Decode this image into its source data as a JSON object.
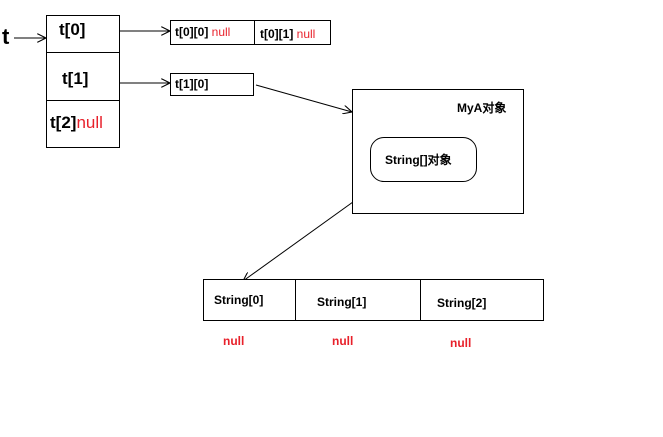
{
  "var_t": "t",
  "outer": {
    "cells": [
      {
        "label": "t[0]",
        "suffix": ""
      },
      {
        "label": "t[1]",
        "suffix": ""
      },
      {
        "label": "t[2]",
        "suffix": "null"
      }
    ]
  },
  "t0_array": {
    "cells": [
      {
        "label": "t[0][0]",
        "suffix": "null"
      },
      {
        "label": "t[0][1]",
        "suffix": "null"
      }
    ]
  },
  "t1_array": {
    "cells": [
      {
        "label": "t[1][0]"
      }
    ]
  },
  "object": {
    "title": "MyA对象",
    "inner_label": "String[]对象"
  },
  "string_array": {
    "cells": [
      "String[0]",
      "String[1]",
      "String[2]"
    ],
    "values": [
      "null",
      "null",
      "null"
    ]
  },
  "colors": {
    "line": "#000000",
    "null_text": "#e8212b"
  }
}
